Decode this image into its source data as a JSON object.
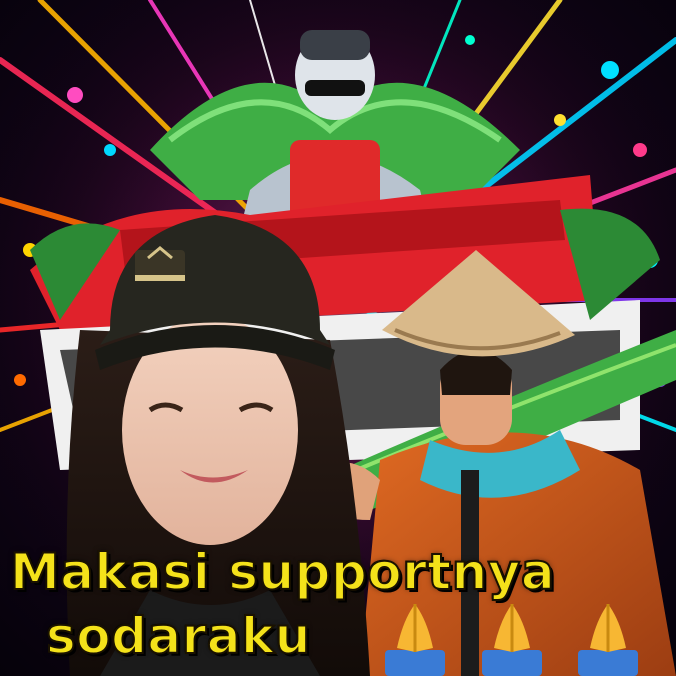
{
  "caption": {
    "line1": "Makasi supportnya",
    "line2": "sodaraku"
  },
  "icons": [
    "folded-hands-icon",
    "folded-hands-icon",
    "folded-hands-icon"
  ],
  "colors": {
    "caption_text": "#f4e21a",
    "logo_red": "#e0222b",
    "grass_green": "#3fae45",
    "shirt_orange": "#c9561e",
    "scarf_blue": "#3ab7c9",
    "cap_black": "#26261f",
    "hat_straw": "#d9b98a"
  }
}
